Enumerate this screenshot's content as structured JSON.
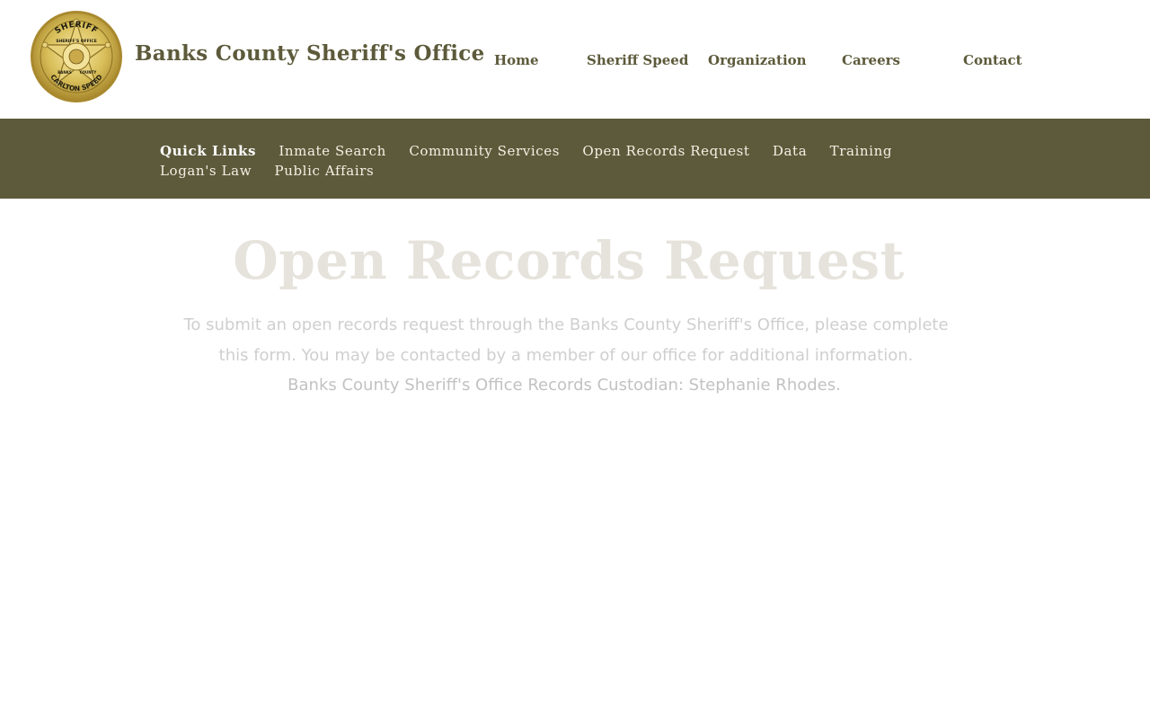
{
  "header": {
    "site_title": "Banks County Sheriff's Office",
    "badge": {
      "icon": "sheriff-star-badge-icon",
      "top_text": "SHERIFF",
      "inner_text": "SHERIFF'S OFFICE",
      "bottom_text": "CARLTON SPEED",
      "side_left": "BANKS",
      "side_right": "COUNTY",
      "colors": {
        "gold": "#d9bf5a",
        "gold_dark": "#a9892e",
        "gold_light": "#f3e29a"
      }
    }
  },
  "main_nav": {
    "items": [
      {
        "label": "Home"
      },
      {
        "label": "Sheriff Speed"
      },
      {
        "label": "Organization"
      },
      {
        "label": "Careers"
      },
      {
        "label": "Contact"
      }
    ]
  },
  "quick_links": {
    "label": "Quick Links",
    "items": [
      {
        "label": "Inmate Search"
      },
      {
        "label": "Community Services"
      },
      {
        "label": "Open Records Request"
      },
      {
        "label": "Data"
      },
      {
        "label": "Training"
      },
      {
        "label": "Logan's Law"
      },
      {
        "label": "Public Affairs"
      }
    ]
  },
  "content": {
    "heading": "Open Records Request",
    "intro": "To submit an open records request through the Banks County Sheriff's Office, please complete this form. You may be contacted by a member of our office for additional information.",
    "custodian": "Banks County Sheriff's Office Records Custodian: Stephanie Rhodes."
  },
  "colors": {
    "brand_olive": "#5d5a3b",
    "band_text": "#f3f0e4",
    "heading": "#e6e3dc",
    "body_text": "#cfcfcf"
  }
}
